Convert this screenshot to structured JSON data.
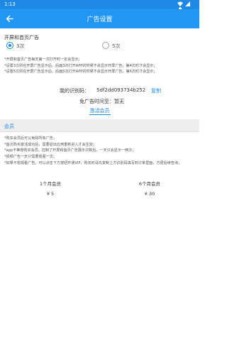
{
  "status_bar": {
    "time": "1:13",
    "icons": [
      "wifi-icon",
      "signal-icon",
      "battery-icon"
    ]
  },
  "app_bar": {
    "title": "广告设置",
    "back_icon": "arrow-back-icon"
  },
  "splash_section": {
    "label": "开屏和首页广告",
    "options": [
      {
        "label": "3次",
        "selected": true
      },
      {
        "label": "5次",
        "selected": false
      }
    ]
  },
  "ad_notes": [
    "*开屏和首页广告每天第一次打开时一定会显示；",
    "*设置3次则在开屏广告显示后，后面3次打开APP的时候不会显示开屏广告，第4次时才会显示；",
    "*设置5次则在开屏广告显示后，后面5次打开APP的时候不会显示开屏广告，第6次时才会显示；"
  ],
  "identity": {
    "code_label": "我的识别码：",
    "code_value": "5df2dd093734b252",
    "copy_label": "复制",
    "free_label": "免广告时间至：",
    "free_value": "暂无",
    "activate_label": "激活会员"
  },
  "membership_section": {
    "title": "会员",
    "notes": [
      "*购买会员后可以免除所有广告；",
      "*首次购买激活成功后，需要退出应用重新进入才会生效；",
      "*app不推荐购买会员，控制了开屏和首页广告展示次数后，一天只会显示一两次；",
      "*视频广告一天只需要观看一次；",
      "*如果不想观看广告，可以点击下方按钮开通VIP，购买时请先复制上方识别码填写到订单里面，方便后续查询；"
    ],
    "plans": [
      {
        "name": "1个月会员",
        "price": "¥ 5"
      },
      {
        "name": "6个月会员",
        "price": "¥ 30"
      }
    ]
  },
  "colors": {
    "primary": "#2196f3",
    "status_bar": "#1e88e5",
    "accent": "#1e88e5",
    "band": "#eeeeee"
  }
}
